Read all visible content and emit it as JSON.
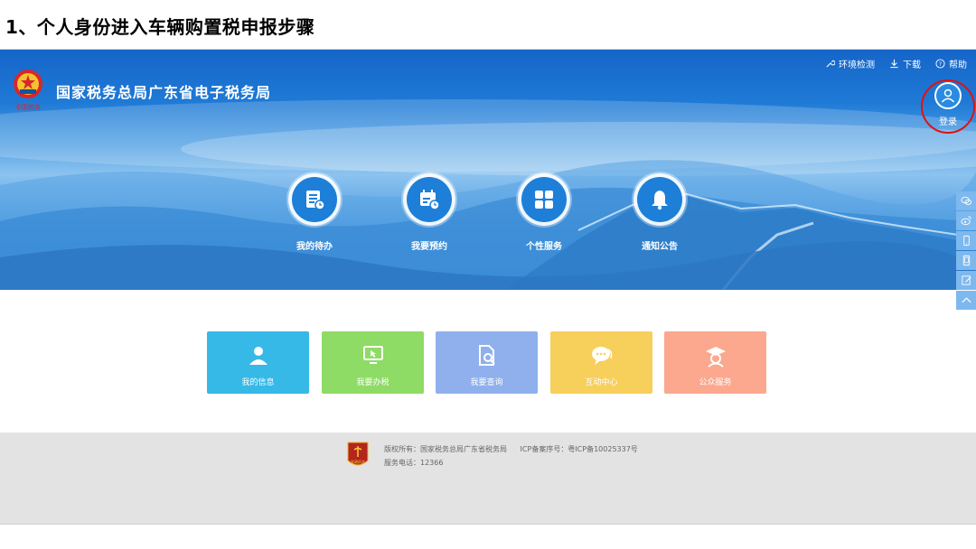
{
  "slide": {
    "title": "1、个人身份进入车辆购置税申报步骤"
  },
  "header": {
    "site_name": "国家税务总局广东省电子税务局",
    "logo_caption": "中国税务",
    "links": [
      {
        "label": "环境检测",
        "icon": "wrench-icon"
      },
      {
        "label": "下载",
        "icon": "download-icon"
      },
      {
        "label": "帮助",
        "icon": "help-icon"
      }
    ],
    "login_label": "登录"
  },
  "quick_nav": [
    {
      "label": "我的待办",
      "icon": "todo-doc-icon"
    },
    {
      "label": "我要预约",
      "icon": "calendar-clock-icon"
    },
    {
      "label": "个性服务",
      "icon": "grid-apps-icon"
    },
    {
      "label": "通知公告",
      "icon": "bell-icon"
    }
  ],
  "side_tools": [
    {
      "icon": "wechat-icon"
    },
    {
      "icon": "weibo-icon"
    },
    {
      "icon": "mobile-icon"
    },
    {
      "icon": "tablet-icon"
    },
    {
      "icon": "edit-icon"
    },
    {
      "icon": "back-to-top-icon"
    }
  ],
  "tiles": [
    {
      "label": "我的信息",
      "color": "#36b9e6",
      "icon": "user-icon"
    },
    {
      "label": "我要办税",
      "color": "#8edb66",
      "icon": "monitor-cursor-icon"
    },
    {
      "label": "我要查询",
      "color": "#8fb0ec",
      "icon": "doc-search-icon"
    },
    {
      "label": "互动中心",
      "color": "#f7cf5b",
      "icon": "chat-bubble-icon"
    },
    {
      "label": "公众服务",
      "color": "#fba88e",
      "icon": "scholar-icon"
    }
  ],
  "footer": {
    "badge_caption": "党政机关",
    "copyright": "版权所有：国家税务总局广东省税务局",
    "icp": "ICP备案序号：粤ICP备10025337号",
    "phone": "服务电话：12366"
  },
  "colors": {
    "highlight": "#e01212",
    "banner_blue": "#1f7ad6",
    "footer_bg": "#e3e3e3"
  }
}
